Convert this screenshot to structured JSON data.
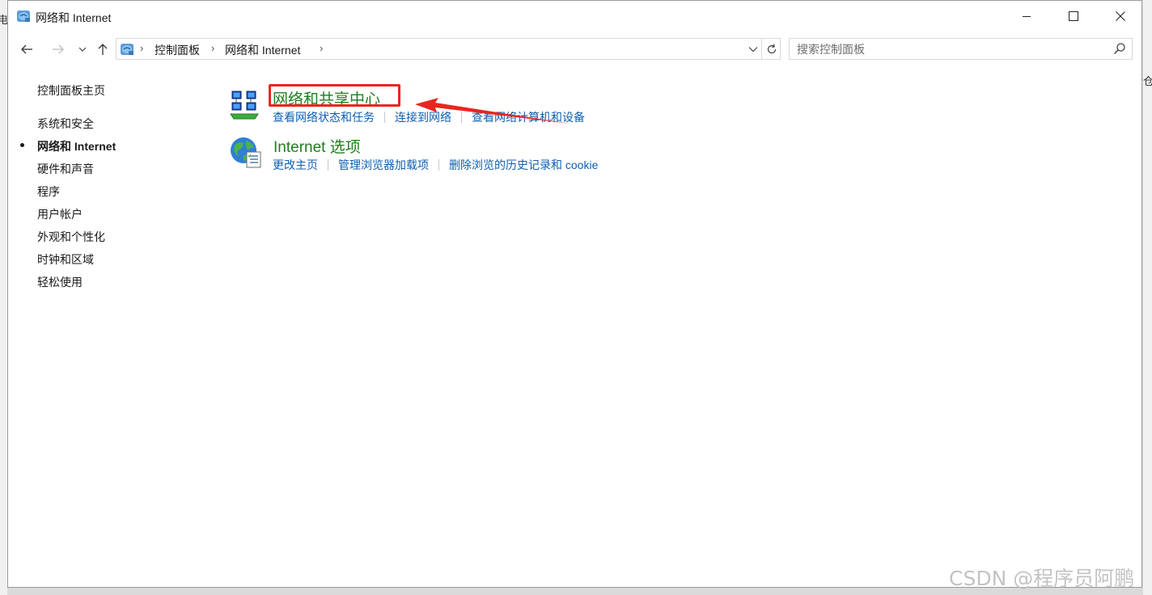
{
  "background": {
    "left_fragment": "电",
    "right_fragment": "仓"
  },
  "window": {
    "title": "网络和 Internet",
    "title_icon": "network-folder-icon"
  },
  "titlebar_buttons": {
    "minimize": "minimize-icon",
    "maximize": "maximize-icon",
    "close": "close-icon"
  },
  "address_bar": {
    "crumbs": [
      "控制面板",
      "网络和 Internet"
    ],
    "search_placeholder": "搜索控制面板"
  },
  "sidebar": {
    "home": "控制面板主页",
    "items": [
      {
        "label": "系统和安全",
        "current": false
      },
      {
        "label": "网络和 Internet",
        "current": true
      },
      {
        "label": "硬件和声音",
        "current": false
      },
      {
        "label": "程序",
        "current": false
      },
      {
        "label": "用户帐户",
        "current": false
      },
      {
        "label": "外观和个性化",
        "current": false
      },
      {
        "label": "时钟和区域",
        "current": false
      },
      {
        "label": "轻松使用",
        "current": false
      }
    ]
  },
  "categories": [
    {
      "title": "网络和共享中心",
      "icon": "network-sharing-center-icon",
      "tasks": [
        "查看网络状态和任务",
        "连接到网络",
        "查看网络计算机和设备"
      ]
    },
    {
      "title": "Internet 选项",
      "icon": "internet-options-globe-icon",
      "tasks": [
        "更改主页",
        "管理浏览器加载项",
        "删除浏览的历史记录和 cookie"
      ]
    }
  ],
  "annotation": {
    "box_color": "#e8261e",
    "arrow_color": "#e8261e"
  },
  "colors": {
    "category_title": "#1f7d1f",
    "task_link": "#0f5fb0"
  },
  "watermark": "CSDN @程序员阿鹏"
}
